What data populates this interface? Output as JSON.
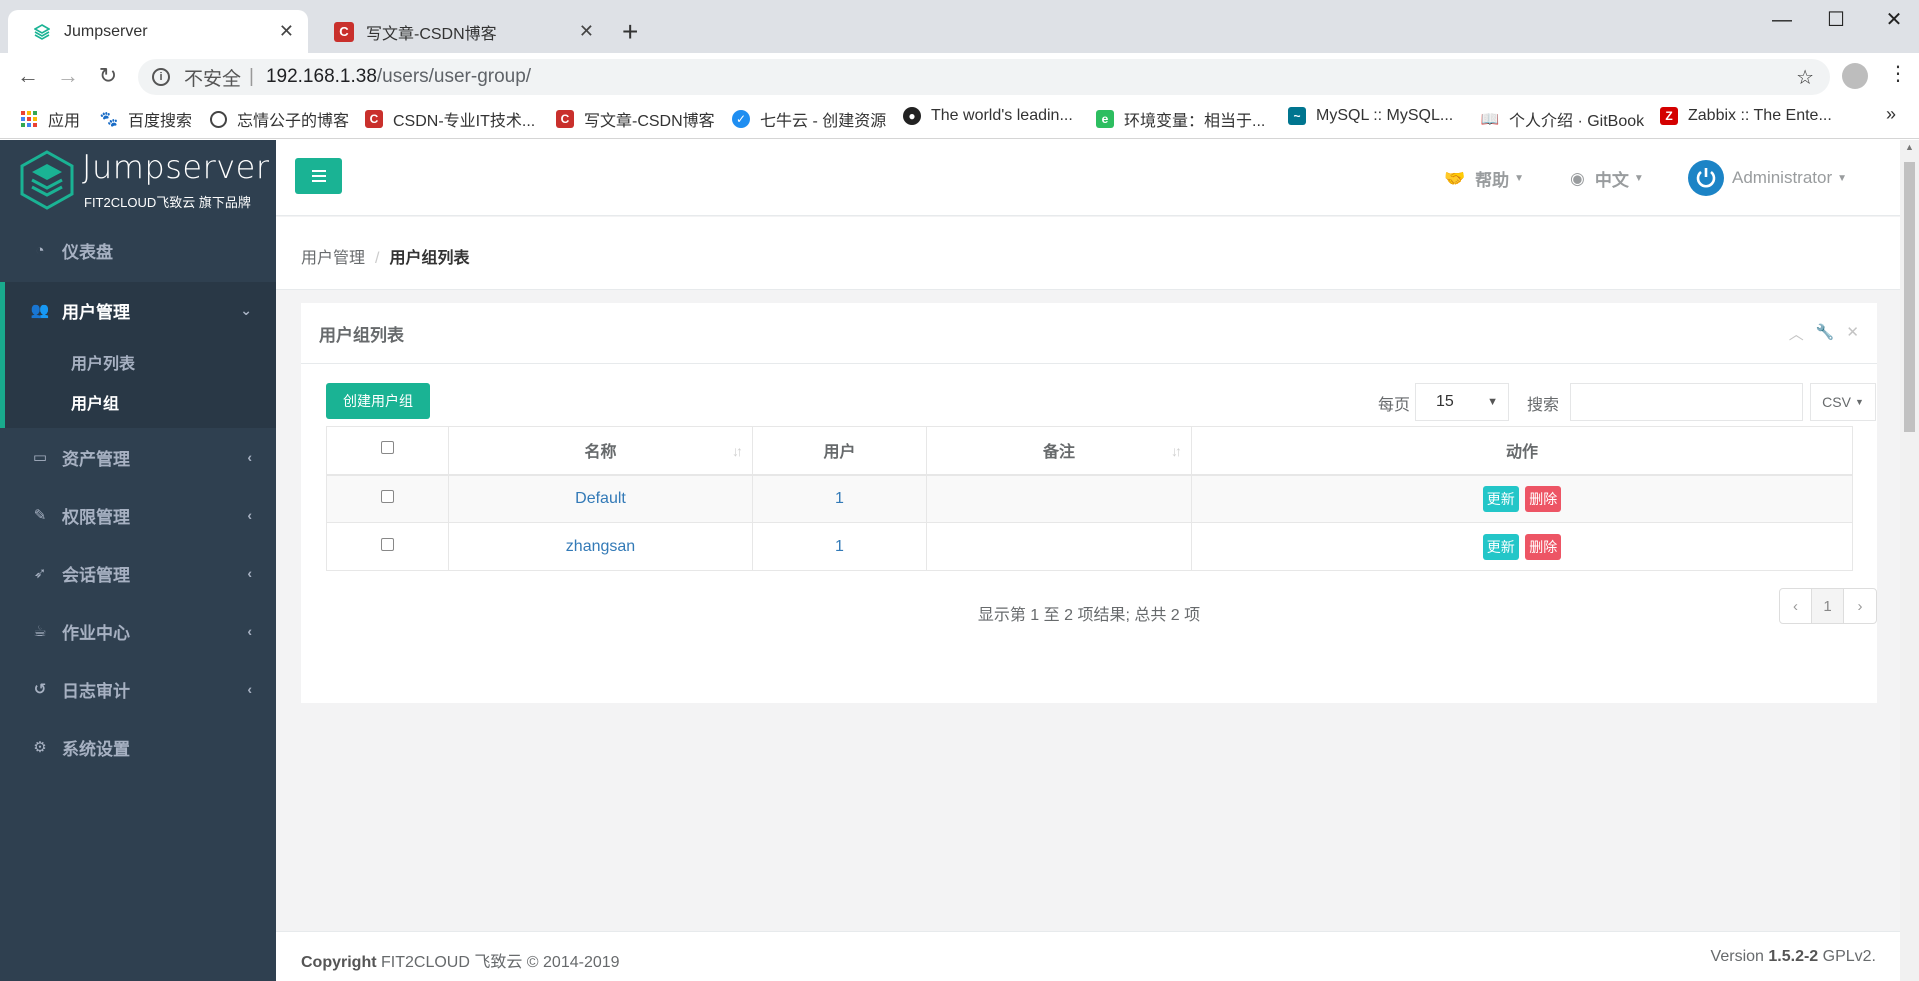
{
  "browser": {
    "tabs": [
      {
        "title": "Jumpserver",
        "active": true
      },
      {
        "title": "写文章-CSDN博客",
        "active": false
      }
    ],
    "new_tab": "+",
    "address": {
      "insecure_label": "不安全",
      "separator": "|",
      "host": "192.168.1.38",
      "path": "/users/user-group/"
    },
    "bookmarks": [
      {
        "label": "应用",
        "icon": "apps-grid-icon"
      },
      {
        "label": "百度搜索",
        "icon": "baidu-icon"
      },
      {
        "label": "忘情公子的博客",
        "icon": "globe-icon"
      },
      {
        "label": "CSDN-专业IT技术...",
        "icon": "csdn-icon"
      },
      {
        "label": "写文章-CSDN博客",
        "icon": "csdn-icon"
      },
      {
        "label": "七牛云 - 创建资源",
        "icon": "qiniu-icon"
      },
      {
        "label": "The world's leadin...",
        "icon": "github-icon"
      },
      {
        "label": "环境变量：相当于...",
        "icon": "evernote-icon"
      },
      {
        "label": "MySQL :: MySQL...",
        "icon": "mysql-icon"
      },
      {
        "label": "个人介绍 · GitBook",
        "icon": "book-icon"
      },
      {
        "label": "Zabbix :: The Ente...",
        "icon": "zabbix-icon"
      }
    ],
    "more": "»"
  },
  "brand": {
    "name": "Jumpserver",
    "sub": "FIT2CLOUD飞致云 旗下品牌",
    "accent": "#1ab394"
  },
  "sidebar": {
    "items": [
      {
        "label": "仪表盘",
        "icon": "dashboard-icon"
      },
      {
        "label": "用户管理",
        "icon": "users-icon",
        "expanded": true
      },
      {
        "label": "资产管理",
        "icon": "hdd-icon"
      },
      {
        "label": "权限管理",
        "icon": "edit-icon"
      },
      {
        "label": "会话管理",
        "icon": "rocket-icon"
      },
      {
        "label": "作业中心",
        "icon": "coffee-icon"
      },
      {
        "label": "日志审计",
        "icon": "history-icon"
      },
      {
        "label": "系统设置",
        "icon": "gears-icon"
      }
    ],
    "submenu": [
      {
        "label": "用户列表",
        "active": false
      },
      {
        "label": "用户组",
        "active": true
      }
    ]
  },
  "topbar": {
    "help": "帮助",
    "language": "中文",
    "user": "Administrator"
  },
  "breadcrumb": {
    "parent": "用户管理",
    "separator": "/",
    "current": "用户组列表"
  },
  "panel": {
    "title": "用户组列表",
    "create_button": "创建用户组",
    "per_page_label": "每页",
    "per_page_value": "15",
    "search_label": "搜索",
    "search_value": "",
    "export_button": "CSV",
    "columns": [
      "名称",
      "用户",
      "备注",
      "动作"
    ],
    "rows": [
      {
        "name": "Default",
        "users": "1",
        "comment": "",
        "update": "更新",
        "delete": "删除"
      },
      {
        "name": "zhangsan",
        "users": "1",
        "comment": "",
        "update": "更新",
        "delete": "删除"
      }
    ],
    "info": "显示第 1 至 2 项结果; 总共 2 项",
    "pagination": {
      "prev": "‹",
      "page": "1",
      "next": "›"
    }
  },
  "footer": {
    "copyright_label": "Copyright",
    "copyright_text": "FIT2CLOUD 飞致云 © 2014-2019",
    "version_label": "Version",
    "version_number": "1.5.2-2",
    "license": "GPLv2."
  }
}
